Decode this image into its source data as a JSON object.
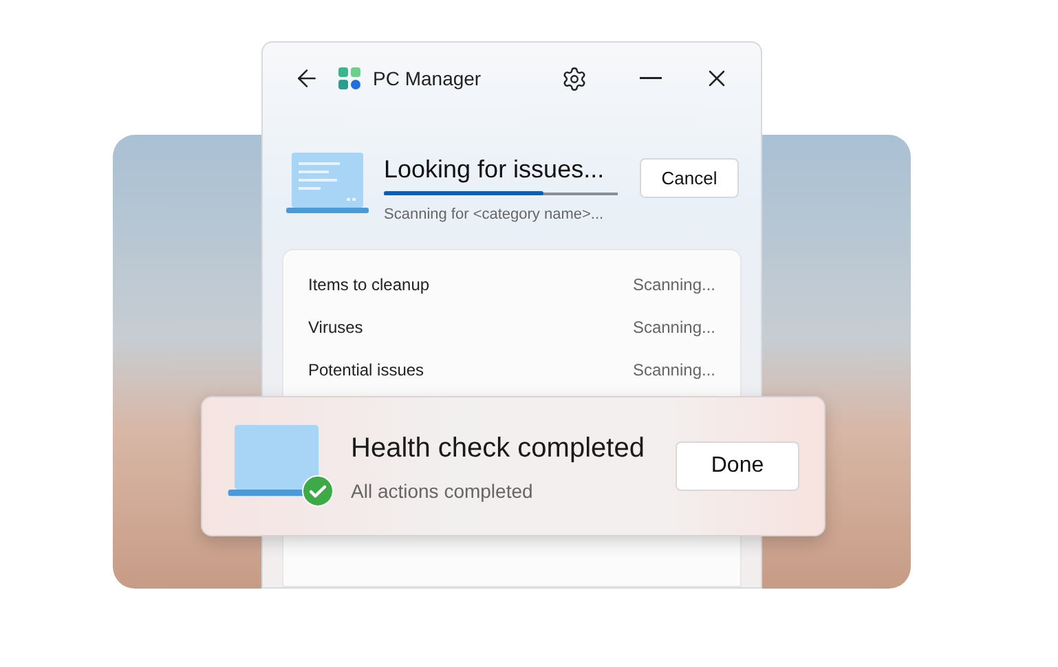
{
  "window": {
    "title": "PC Manager"
  },
  "scan": {
    "title": "Looking for issues...",
    "level": 0.68,
    "subtitle": "Scanning for <category name>...",
    "cancel_button": "Cancel"
  },
  "items": [
    {
      "label": "Items to cleanup",
      "status": "Scanning..."
    },
    {
      "label": "Viruses",
      "status": "Scanning..."
    },
    {
      "label": "Potential issues",
      "status": "Scanning..."
    }
  ],
  "notification": {
    "title": "Health check completed",
    "subtitle": "All actions completed",
    "done_button": "Done"
  }
}
